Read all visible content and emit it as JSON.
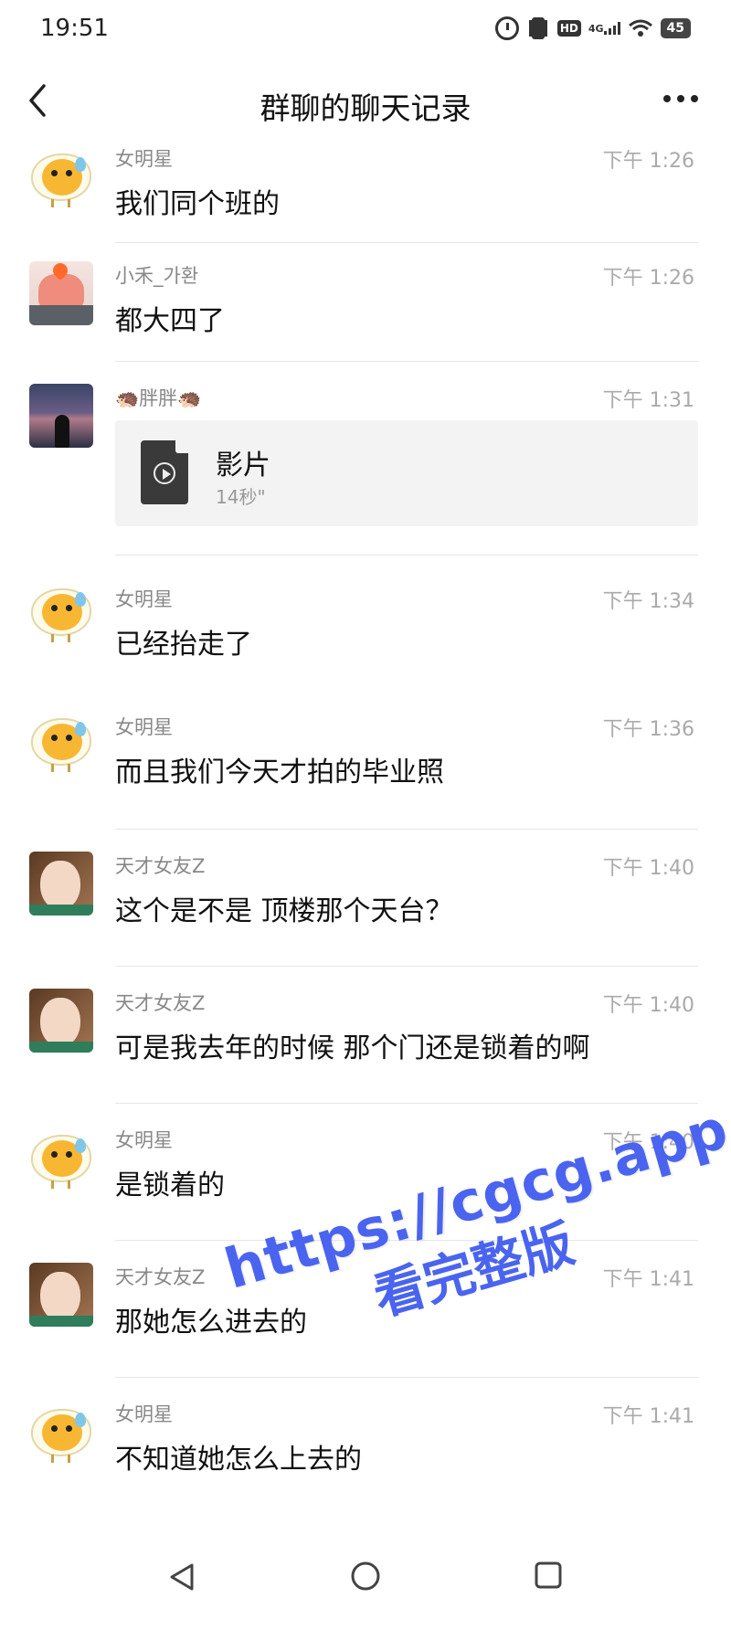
{
  "status_bar": {
    "time": "19:51",
    "hd": "HD",
    "network": "4G",
    "battery": "45"
  },
  "header": {
    "title": "群聊的聊天记录"
  },
  "messages": [
    {
      "sender": "女明星",
      "time": "下午 1:26",
      "text": "我们同个班的",
      "avatar": "egg"
    },
    {
      "sender": "小禾_가환",
      "time": "下午 1:26",
      "text": "都大四了",
      "avatar": "pink"
    },
    {
      "sender": "🦔胖胖🦔",
      "time": "下午 1:31",
      "file_name": "影片",
      "file_duration": "14秒\"",
      "avatar": "night"
    },
    {
      "sender": "女明星",
      "time": "下午 1:34",
      "text": "已经抬走了",
      "avatar": "egg"
    },
    {
      "sender": "女明星",
      "time": "下午 1:36",
      "text": "而且我们今天才拍的毕业照",
      "avatar": "egg"
    },
    {
      "sender": "天才女友Z",
      "time": "下午 1:40",
      "text": "这个是不是 顶楼那个天台？",
      "avatar": "girl"
    },
    {
      "sender": "天才女友Z",
      "time": "下午 1:40",
      "text": "可是我去年的时候 那个门还是锁着的啊",
      "avatar": "girl"
    },
    {
      "sender": "女明星",
      "time": "下午 1:40",
      "text": "是锁着的",
      "avatar": "egg"
    },
    {
      "sender": "天才女友Z",
      "time": "下午 1:41",
      "text": "那她怎么进去的",
      "avatar": "girl"
    },
    {
      "sender": "女明星",
      "time": "下午 1:41",
      "text": "不知道她怎么上去的",
      "avatar": "egg"
    }
  ],
  "watermark": {
    "url": "https://cgcg.app",
    "subtitle": "看完整版"
  },
  "colors": {
    "watermark": "#4a64f0",
    "timestamp": "#aaaaaa",
    "sender": "#888888"
  }
}
